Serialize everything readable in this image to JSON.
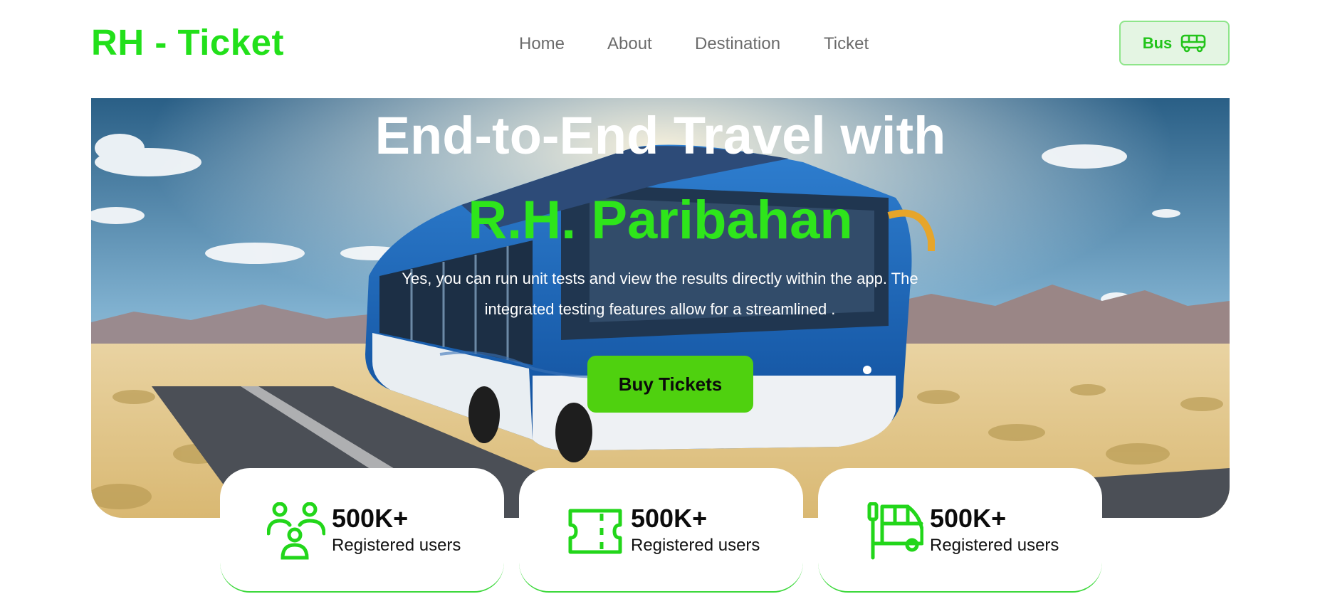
{
  "header": {
    "logo": "RH - Ticket",
    "nav": [
      "Home",
      "About",
      "Destination",
      "Ticket"
    ],
    "bus_button_label": "Bus",
    "bus_button_icon": "bus-icon"
  },
  "hero": {
    "title": "End-to-End Travel with",
    "brand": "R.H. Paribahan",
    "description": "Yes, you can run unit tests and view the results directly within the app. The integrated testing features allow for a streamlined .",
    "cta_label": "Buy Tickets",
    "background": "solar-powered blue bus on a desert highway under a blue sky"
  },
  "stats": [
    {
      "icon": "users-icon",
      "value": "500K+",
      "label": "Registered users"
    },
    {
      "icon": "ticket-icon",
      "value": "500K+",
      "label": "Registered users"
    },
    {
      "icon": "bus-stop-icon",
      "value": "500K+",
      "label": "Registered users"
    }
  ],
  "colors": {
    "brand_green": "#22e01a",
    "cta_green": "#4fd10f",
    "nav_gray": "#6b6b6b",
    "bus_button_bg": "#e4f5e3"
  }
}
